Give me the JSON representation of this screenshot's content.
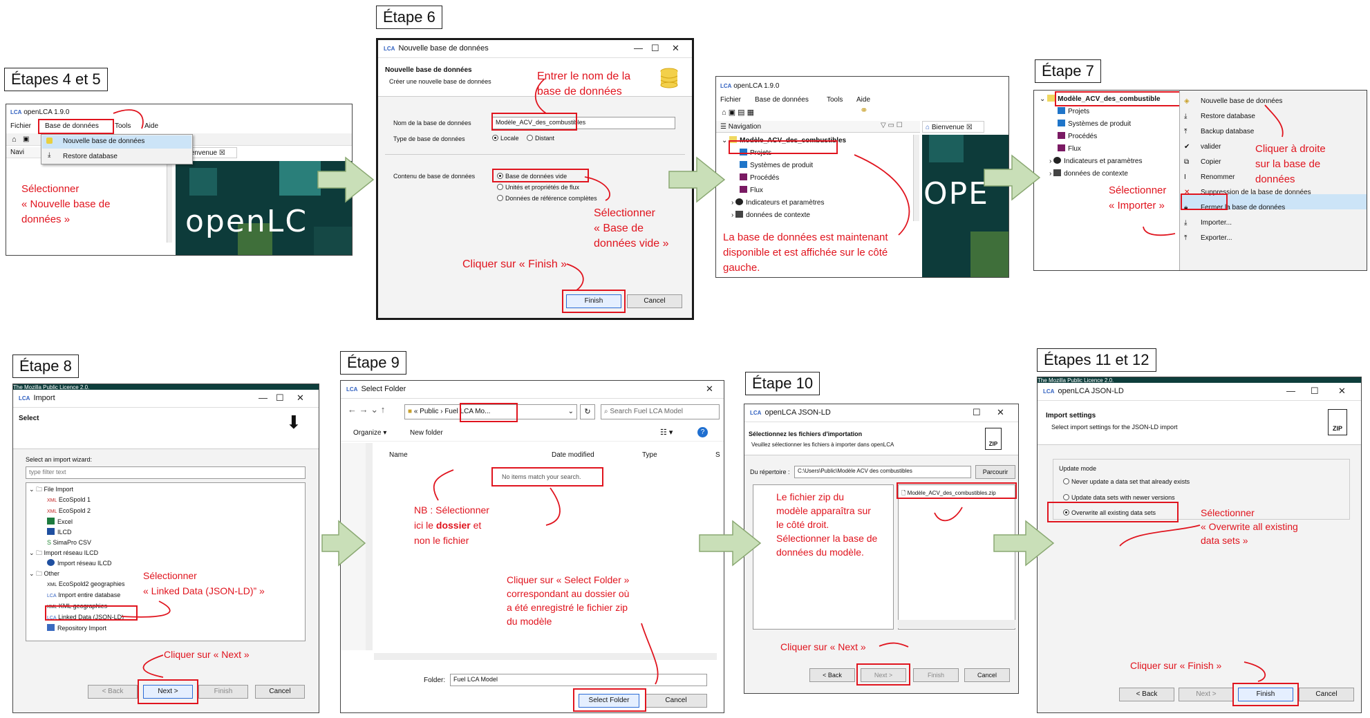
{
  "steps": {
    "s45": {
      "label": "Étapes 4 et 5",
      "app_title": "openLCA 1.9.0",
      "menu": [
        "Fichier",
        "Base de données",
        "Tools",
        "Aide"
      ],
      "dropdown": [
        "Nouvelle base de données",
        "Restore database"
      ],
      "nav_tab": "Navi",
      "bienvenue": "Bienvenue",
      "logo_text": "openLC",
      "annotation": "Sélectionner\n« Nouvelle base de\ndonnées »"
    },
    "s6": {
      "label": "Étape 6",
      "win_title": "Nouvelle base de données",
      "heading": "Nouvelle base de données",
      "subheading": "Créer une nouvelle base de données",
      "name_label": "Nom de la base de données",
      "name_value": "Modèle_ACV_des_combustibles",
      "type_label": "Type de base de données",
      "type_options": [
        "Locale",
        "Distant"
      ],
      "content_label": "Contenu de base de données",
      "content_options": [
        "Base de données vide",
        "Unités et propriétés de flux",
        "Données de référence complètes"
      ],
      "ann_name": "Entrer le nom de la\nbase de données",
      "ann_empty": "Sélectionner\n« Base de\ndonnées vide »",
      "ann_finish": "Cliquer sur « Finish »",
      "finish": "Finish",
      "cancel": "Cancel"
    },
    "snav": {
      "app_title": "openLCA 1.9.0",
      "menu": [
        "Fichier",
        "Base de données",
        "Tools",
        "Aide"
      ],
      "nav_tab": "Navigation",
      "bienvenue": "Bienvenue",
      "db": "Modèle_ACV_des_combustibles",
      "tree": [
        "Projets",
        "Systèmes de produit",
        "Procédés",
        "Flux",
        "Indicateurs et paramètres",
        "données de contexte"
      ],
      "logo_text": "OPE",
      "annotation": "La base de données est maintenant\ndisponible et est affichée sur le côté\ngauche."
    },
    "s7": {
      "label": "Étape 7",
      "db": "Modèle_ACV_des_combustible",
      "tree": [
        "Projets",
        "Systèmes de produit",
        "Procédés",
        "Flux",
        "Indicateurs et paramètres",
        "données de contexte"
      ],
      "context": [
        "Nouvelle base de données",
        "Restore database",
        "Backup database",
        "valider",
        "Copier",
        "Renommer",
        "Suppression de la base de données",
        "Fermer la base de données",
        "Importer...",
        "Exporter..."
      ],
      "ann_right": "Cliquer à droite\nsur la base de\ndonnées",
      "ann_import": "Sélectionner\n« Importer »"
    },
    "s8": {
      "label": "Étape 8",
      "win_title": "Import",
      "heading": "Select",
      "wizard_label": "Select an import wizard:",
      "filter_placeholder": "type filter text",
      "tree": [
        "File Import",
        "EcoSpold 1",
        "EcoSpold 2",
        "Excel",
        "ILCD",
        "SimaPro CSV",
        "Import réseau ILCD",
        "Import réseau ILCD",
        "Other",
        "EcoSpold2 geographies",
        "Import entire database",
        "KML geographies",
        "Linked Data (JSON-LD)",
        "Repository Import"
      ],
      "ann_linked": "Sélectionner\n« Linked Data (JSON-LD)” »",
      "ann_next": "Cliquer sur « Next »",
      "buttons": [
        "< Back",
        "Next >",
        "Finish",
        "Cancel"
      ],
      "bg_text": "The Mozilla Public Licence 2.0."
    },
    "s9": {
      "label": "Étape 9",
      "win_title": "Select Folder",
      "path": [
        "«",
        "Public",
        "Fuel LCA Mo..."
      ],
      "search_placeholder": "Search Fuel LCA Model",
      "organize": "Organize ▾",
      "new_folder": "New folder",
      "cols": [
        "Name",
        "Date modified",
        "Type",
        "S"
      ],
      "empty": "No items match your search.",
      "ann_nb_a": "NB : Sélectionner\nici le ",
      "ann_nb_b": "dossier",
      "ann_nb_c": " et\nnon le fichier",
      "ann_select": "Cliquer sur « Select Folder »\ncorrespondant au dossier où\na été enregistré le fichier zip\ndu modèle",
      "folder_label": "Folder:",
      "folder_value": "Fuel LCA Model",
      "select_btn": "Select Folder",
      "cancel": "Cancel"
    },
    "s10": {
      "label": "Étape 10",
      "win_title": "openLCA JSON-LD",
      "heading": "Sélectionnez les fichiers d'importation",
      "subheading": "Veuillez sélectionner les fichiers à importer dans openLCA",
      "dir_label": "Du répertoire :",
      "dir_value": "C:\\Users\\Public\\Modèle ACV des combustibles",
      "browse": "Parcourir",
      "file": "Modèle_ACV_des_combustibles.zip",
      "ann_file": "Le fichier zip du\nmodèle apparaîtra sur\nle côté droit.\nSélectionner la base de\ndonnées du modèle.",
      "ann_next": "Cliquer sur « Next »",
      "buttons": [
        "< Back",
        "Next >",
        "Finish",
        "Cancel"
      ]
    },
    "s1112": {
      "label": "Étapes 11 et 12",
      "win_title": "openLCA JSON-LD",
      "heading": "Import settings",
      "subheading": "Select import settings for the JSON-LD import",
      "mode_label": "Update mode",
      "modes": [
        "Never update a data set that already exists",
        "Update data sets with newer versions",
        "Overwrite all existing data sets"
      ],
      "ann_overwrite": "Sélectionner\n« Overwrite all existing\ndata sets »",
      "ann_finish": "Cliquer sur « Finish »",
      "buttons": [
        "< Back",
        "Next >",
        "Finish",
        "Cancel"
      ],
      "bg_text": "The Mozilla Public Licence 2.0."
    }
  },
  "colors": {
    "annotation": "#e0141e",
    "arrow": "#c9dfb8",
    "arrow_border": "#8aa872"
  }
}
